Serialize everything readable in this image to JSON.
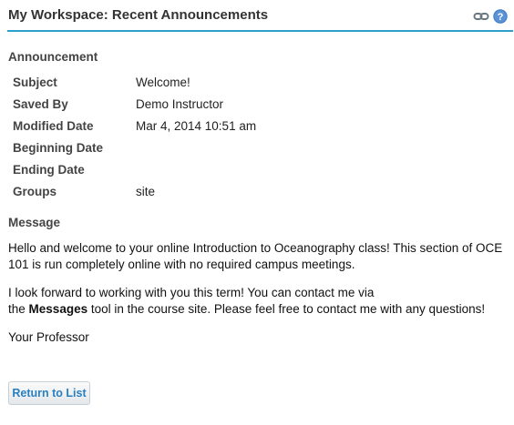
{
  "header": {
    "title": "My Workspace: Recent Announcements",
    "link_icon": "link-icon",
    "help_icon": "help-icon",
    "accent_color": "#2a9fd0"
  },
  "announcement": {
    "heading": "Announcement",
    "fields": [
      {
        "label": "Subject",
        "value": "Welcome!"
      },
      {
        "label": "Saved By",
        "value": "Demo Instructor"
      },
      {
        "label": "Modified Date",
        "value": "Mar 4, 2014 10:51 am"
      },
      {
        "label": "Beginning Date",
        "value": ""
      },
      {
        "label": "Ending Date",
        "value": ""
      },
      {
        "label": "Groups",
        "value": "site"
      }
    ]
  },
  "message": {
    "heading": "Message",
    "paragraph1": "Hello and welcome to your online Introduction to Oceanography class!  This section of OCE 101 is run completely online with no required campus meetings.",
    "paragraph2_start": "I look forward to working with you this term!   You can contact me via",
    "paragraph2_the": "the",
    "paragraph2_bold": "Messages",
    "paragraph2_end": "tool in the course site. Please feel free to contact me with any questions!",
    "signature": "Your Professor"
  },
  "actions": {
    "return_label": "Return to List"
  }
}
